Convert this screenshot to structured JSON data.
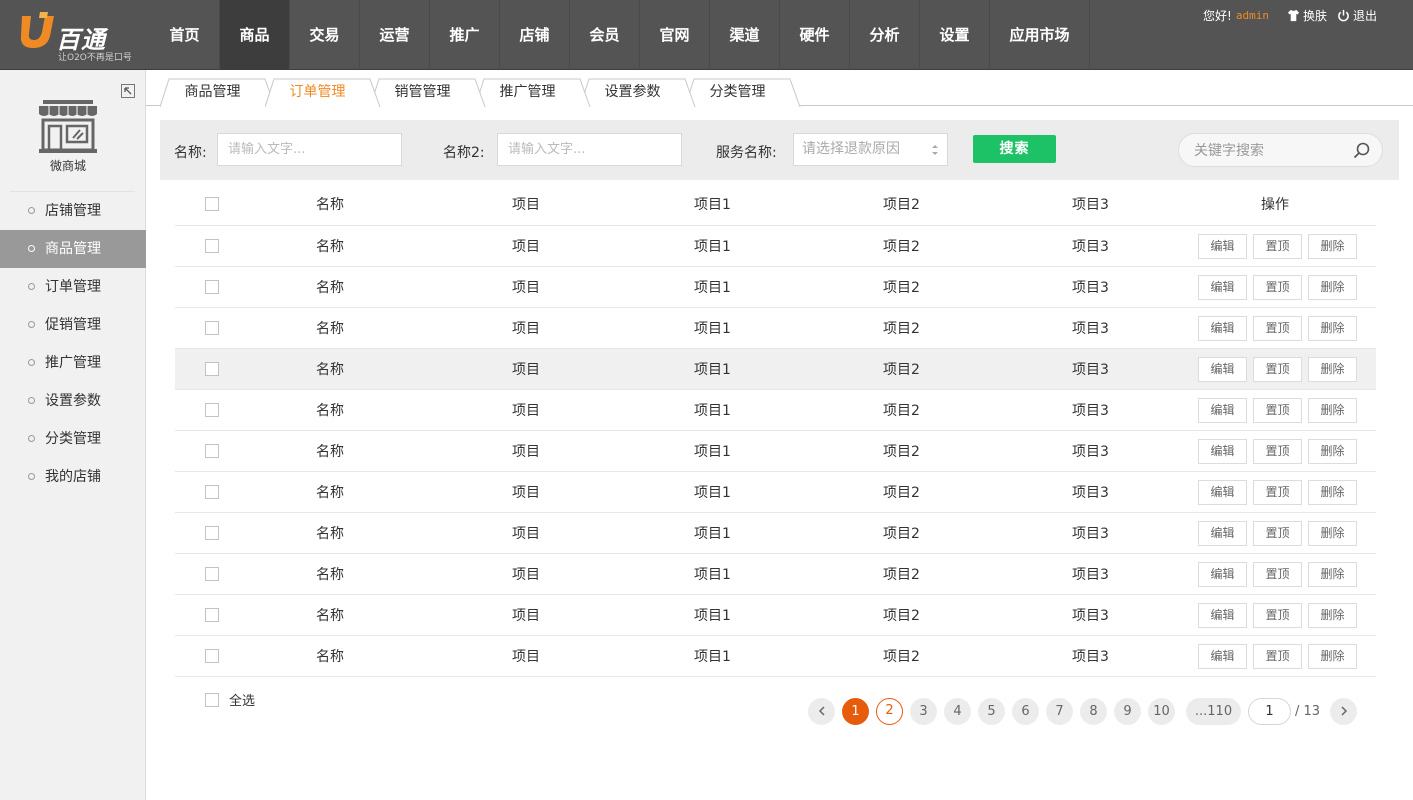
{
  "brand": {
    "name": "百通",
    "slogan": "让O2O不再是口号",
    "accent": "#f08a24"
  },
  "nav": {
    "items": [
      "首页",
      "商品",
      "交易",
      "运营",
      "推广",
      "店铺",
      "会员",
      "官网",
      "渠道",
      "硬件",
      "分析",
      "设置",
      "应用市场"
    ],
    "active": "商品"
  },
  "user": {
    "greeting": "您好!",
    "name": "admin",
    "skin_label": "换肤",
    "logout_label": "退出"
  },
  "sidebar": {
    "shop_label": "微商城",
    "items": [
      "店铺管理",
      "商品管理",
      "订单管理",
      "促销管理",
      "推广管理",
      "设置参数",
      "分类管理",
      "我的店铺"
    ],
    "active": "商品管理"
  },
  "tabs": {
    "items": [
      "商品管理",
      "订单管理",
      "销管管理",
      "推广管理",
      "设置参数",
      "分类管理"
    ],
    "active": "订单管理"
  },
  "search": {
    "name_label": "名称:",
    "name_placeholder": "请输入文字...",
    "name2_label": "名称2:",
    "name2_placeholder": "请输入文字...",
    "service_label": "服务名称:",
    "service_placeholder": "请选择退款原因",
    "button_label": "搜索",
    "keyword_placeholder": "关键字搜索"
  },
  "table": {
    "columns": [
      "名称",
      "项目",
      "项目1",
      "项目2",
      "项目3",
      "操作"
    ],
    "rows": [
      [
        "名称",
        "项目",
        "项目1",
        "项目2",
        "项目3"
      ],
      [
        "名称",
        "项目",
        "项目1",
        "项目2",
        "项目3"
      ],
      [
        "名称",
        "项目",
        "项目1",
        "项目2",
        "项目3"
      ],
      [
        "名称",
        "项目",
        "项目1",
        "项目2",
        "项目3"
      ],
      [
        "名称",
        "项目",
        "项目1",
        "项目2",
        "项目3"
      ],
      [
        "名称",
        "项目",
        "项目1",
        "项目2",
        "项目3"
      ],
      [
        "名称",
        "项目",
        "项目1",
        "项目2",
        "项目3"
      ],
      [
        "名称",
        "项目",
        "项目1",
        "项目2",
        "项目3"
      ],
      [
        "名称",
        "项目",
        "项目1",
        "项目2",
        "项目3"
      ],
      [
        "名称",
        "项目",
        "项目1",
        "项目2",
        "项目3"
      ],
      [
        "名称",
        "项目",
        "项目1",
        "项目2",
        "项目3"
      ]
    ],
    "highlighted_row": 3,
    "actions": [
      "编辑",
      "置顶",
      "删除"
    ],
    "select_all_label": "全选"
  },
  "pagination": {
    "pages": [
      "1",
      "2",
      "3",
      "4",
      "5",
      "6",
      "7",
      "8",
      "9",
      "10",
      "...110"
    ],
    "current": "1",
    "input_value": "1",
    "total_label": "/ 13"
  },
  "colors": {
    "topbar": "#545454",
    "primary_button": "#1ec266",
    "page_current": "#e65c0c"
  }
}
